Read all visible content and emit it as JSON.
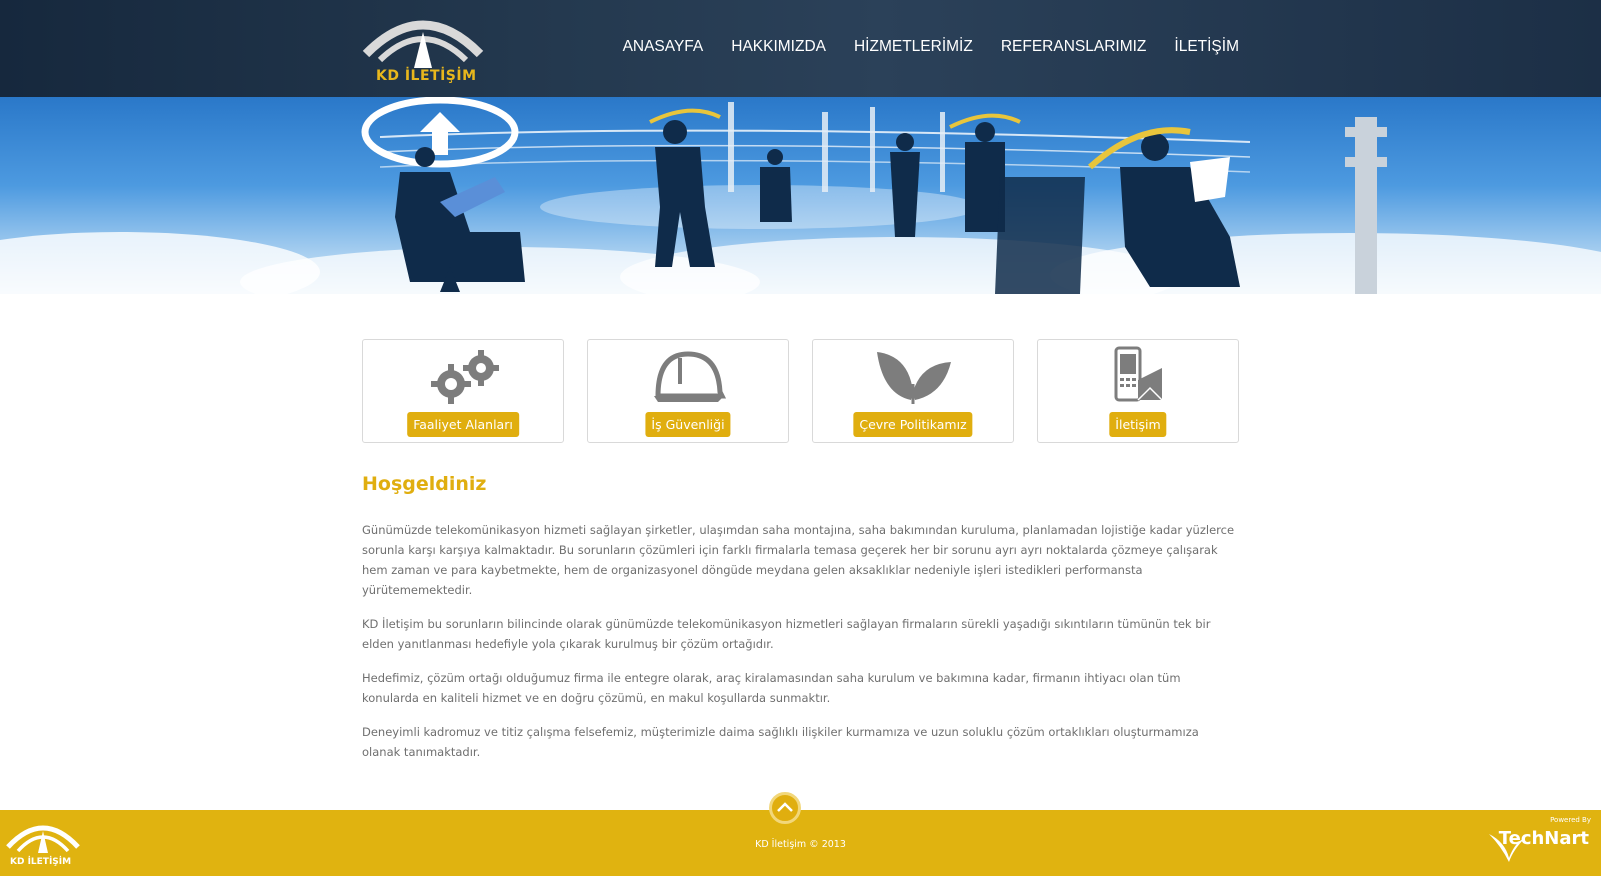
{
  "header": {
    "logo_text": "KD İLETİŞİM",
    "nav": [
      "ANASAYFA",
      "HAKKIMIZDA",
      "HİZMETLERİMİZ",
      "REFERANSLARIMIZ",
      "İLETİŞİM"
    ]
  },
  "boxes": [
    {
      "label": "Faaliyet Alanları",
      "icon": "gears-icon"
    },
    {
      "label": "İş Güvenliği",
      "icon": "hard-hat-icon"
    },
    {
      "label": "Çevre Politikamız",
      "icon": "leaf-icon"
    },
    {
      "label": "İletişim",
      "icon": "phone-envelope-icon"
    }
  ],
  "content": {
    "title": "Hoşgeldiniz",
    "paragraphs": [
      "Günümüzde telekomünikasyon hizmeti sağlayan şirketler, ulaşımdan saha montajına, saha bakımından kuruluma, planlamadan lojistiğe kadar yüzlerce sorunla karşı karşıya kalmaktadır. Bu sorunların çözümleri için farklı firmalarla temasa geçerek her bir sorunu ayrı ayrı noktalarda çözmeye çalışarak hem zaman ve para kaybetmekte, hem de organizasyonel döngüde meydana gelen aksaklıklar nedeniyle işleri istedikleri performansta yürütememektedir.",
      "KD İletişim bu sorunların bilincinde olarak günümüzde telekomünikasyon hizmetleri sağlayan firmaların sürekli yaşadığı sıkıntıların tümünün tek bir elden yanıtlanması hedefiyle yola çıkarak kurulmuş bir çözüm ortağıdır.",
      "Hedefimiz, çözüm ortağı olduğumuz firma ile entegre olarak, araç kiralamasından saha kurulum ve bakımına kadar, firmanın ihtiyacı olan tüm konularda en kaliteli hizmet ve en doğru çözümü, en makul koşullarda sunmaktır.",
      "Deneyimli kadromuz ve titiz çalışma felsefemiz, müşterimizle daima sağlıklı ilişkiler kurmamıza ve uzun soluklu çözüm ortaklıkları oluşturmamıza olanak tanımaktadır."
    ]
  },
  "footer": {
    "logo_text": "KD İLETİŞİM",
    "copyright": "KD İletişim © 2013",
    "powered_by": "Powered By",
    "powered_brand": "TechNart"
  },
  "colors": {
    "accent": "#e0ae0f",
    "header_bg": "#1c2f46",
    "text": "#6f6f6f"
  }
}
